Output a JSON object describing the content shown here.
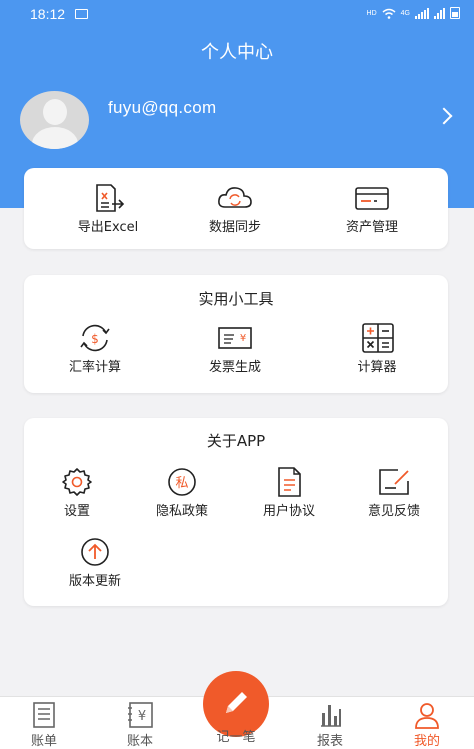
{
  "status_bar": {
    "time": "18:12",
    "network_label": "HD",
    "cell_label": "4G"
  },
  "header": {
    "title": "个人中心"
  },
  "user": {
    "email": "fuyu@qq.com"
  },
  "quick_actions": [
    {
      "label": "导出Excel",
      "icon": "excel-export-icon"
    },
    {
      "label": "数据同步",
      "icon": "cloud-sync-icon"
    },
    {
      "label": "资产管理",
      "icon": "card-icon"
    }
  ],
  "tools": {
    "title": "实用小工具",
    "items": [
      {
        "label": "汇率计算",
        "icon": "exchange-rate-icon"
      },
      {
        "label": "发票生成",
        "icon": "invoice-icon"
      },
      {
        "label": "计算器",
        "icon": "calculator-icon"
      }
    ]
  },
  "about": {
    "title": "关于APP",
    "items": [
      {
        "label": "设置",
        "icon": "gear-icon"
      },
      {
        "label": "隐私政策",
        "icon": "privacy-icon",
        "glyph": "私"
      },
      {
        "label": "用户协议",
        "icon": "document-icon"
      },
      {
        "label": "意见反馈",
        "icon": "feedback-icon"
      },
      {
        "label": "版本更新",
        "icon": "upload-arrow-icon"
      }
    ]
  },
  "tabbar": {
    "items": [
      {
        "label": "账单",
        "icon": "bill-icon",
        "active": false
      },
      {
        "label": "账本",
        "icon": "ledger-icon",
        "active": false
      },
      {
        "label": "记一笔",
        "icon": "pencil-icon",
        "active": false
      },
      {
        "label": "报表",
        "icon": "bar-chart-icon",
        "active": false
      },
      {
        "label": "我的",
        "icon": "person-icon",
        "active": true
      }
    ]
  },
  "colors": {
    "primary": "#4c97f0",
    "accent": "#f05a2a",
    "background": "#f2f2f4"
  }
}
